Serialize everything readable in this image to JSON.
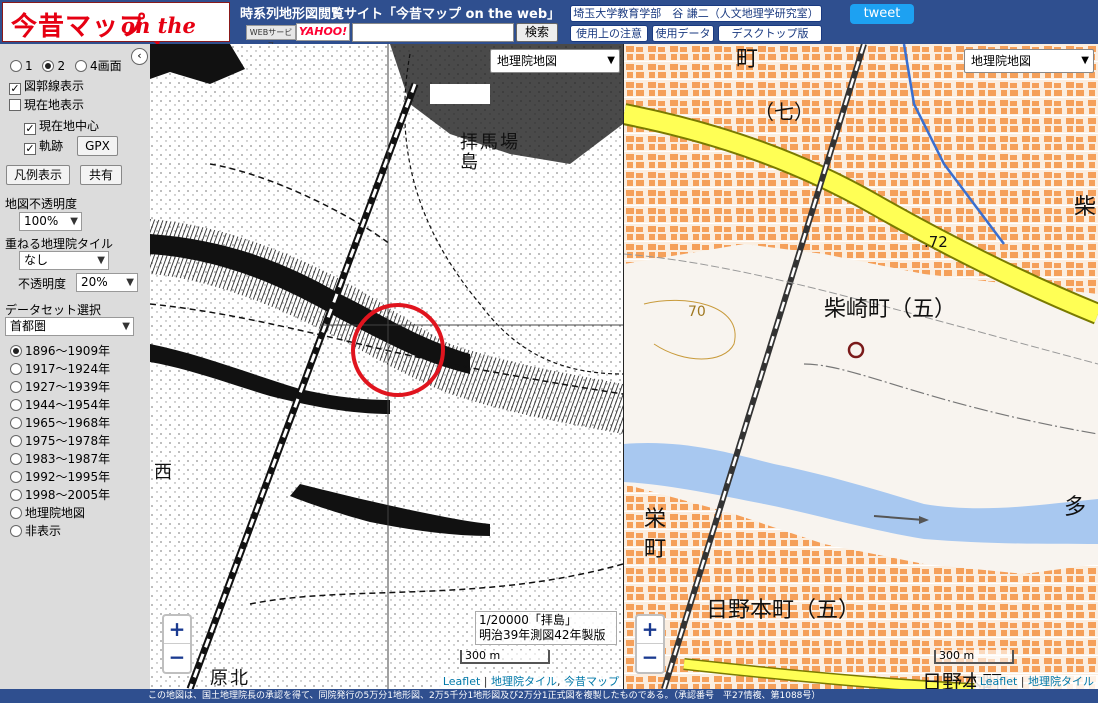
{
  "header": {
    "logo_ja": "今昔マップ",
    "logo_en": "on the web",
    "site_title": "時系列地形図閲覧サイト「今昔マップ on the web」",
    "websvc_label": "WEBサービス",
    "yahoo_label": "YAHOO!",
    "search_value": "",
    "search_label": "検索",
    "author_link": "埼玉大学教育学部　谷 謙二（人文地理学研究室）",
    "notice_link": "使用上の注意",
    "data_link": "使用データ",
    "desktop_link": "デスクトップ版",
    "tweet_label": "tweet"
  },
  "sidebar": {
    "collapse_icon": "‹",
    "screens": [
      {
        "label": "1",
        "selected": false
      },
      {
        "label": "2",
        "selected": true
      },
      {
        "label": "4画面",
        "selected": false
      }
    ],
    "show_grid": {
      "label": "図郭線表示",
      "checked": true
    },
    "show_location": {
      "label": "現在地表示",
      "checked": false
    },
    "center_location": {
      "label": "現在地中心",
      "checked": true
    },
    "track": {
      "label": "軌跡",
      "checked": true
    },
    "gpx_label": "GPX",
    "legend_label": "凡例表示",
    "share_label": "共有",
    "opacity_label": "地図不透明度",
    "opacity_value": "100%",
    "overlay_label": "重ねる地理院タイル",
    "overlay_value": "なし",
    "overlay_opacity_label": "不透明度",
    "overlay_opacity_value": "20%",
    "dataset_label": "データセット選択",
    "dataset_value": "首都圏",
    "periods": [
      {
        "label": "1896～1909年",
        "selected": true
      },
      {
        "label": "1917～1924年",
        "selected": false
      },
      {
        "label": "1927～1939年",
        "selected": false
      },
      {
        "label": "1944～1954年",
        "selected": false
      },
      {
        "label": "1965～1968年",
        "selected": false
      },
      {
        "label": "1975～1978年",
        "selected": false
      },
      {
        "label": "1983～1987年",
        "selected": false
      },
      {
        "label": "1992～1995年",
        "selected": false
      },
      {
        "label": "1998～2005年",
        "selected": false
      },
      {
        "label": "地理院地図",
        "selected": false
      },
      {
        "label": "非表示",
        "selected": false
      }
    ]
  },
  "map_left": {
    "layer_select": "地理院地図",
    "caption_line1": "1/20000「拝島」",
    "caption_line2": "明治39年測図42年製版",
    "scale_label": "300 m",
    "place_labels": [
      "拝",
      "島",
      "馬",
      "場",
      "西",
      "原",
      "北"
    ],
    "attrib_leaflet": "Leaflet",
    "attrib_gsi": "地理院タイル",
    "attrib_konjaku": "今昔マップ",
    "zoom_in": "+",
    "zoom_out": "−"
  },
  "map_right": {
    "layer_select": "地理院地図",
    "labels": {
      "shibasaki": "柴崎町（五）",
      "hinomoto": "日野本町（五）",
      "machi_top": "町",
      "nana": "（七）",
      "sakae": "栄",
      "machi_left": "町",
      "ta": "多",
      "shiba": "柴",
      "elev_72": ".72",
      "elev_70": "70",
      "hinomoto_bottom": "日野本町"
    },
    "scale_label": "300 m",
    "attrib_leaflet": "Leaflet",
    "attrib_gsi": "地理院タイル",
    "zoom_in": "+",
    "zoom_out": "−"
  },
  "footer": {
    "text": "この地図は、国土地理院長の承認を得て、同院発行の5万分1地形図、2万5千分1地形図及び2万分1正式図を複製したものである。（承認番号　平27情複、第1088号）"
  },
  "colors": {
    "header_bg": "#2f4f8f",
    "sidebar_bg": "#dcdcdc",
    "road_yellow": "#ffff55",
    "building_orange": "#f5a05a",
    "river_blue": "#a8c8f0",
    "marker_red": "#e0141e"
  }
}
